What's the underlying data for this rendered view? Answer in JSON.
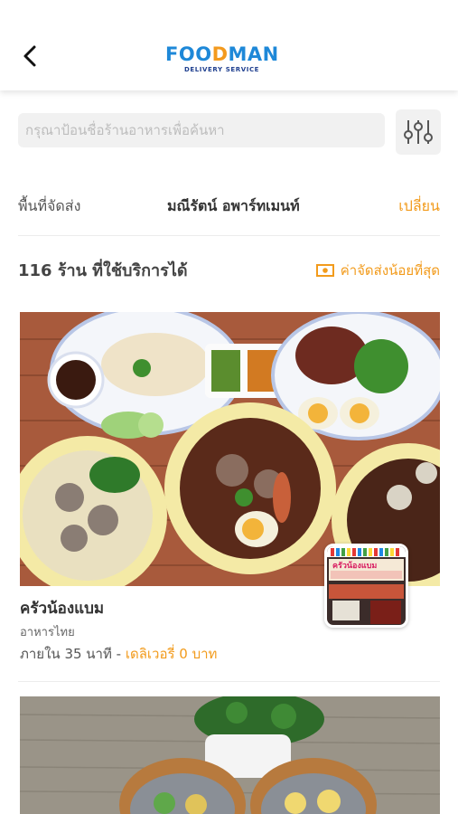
{
  "header": {
    "logo_part1": "FOO",
    "logo_part2": "D",
    "logo_part3": "MAN",
    "logo_subtitle": "DELIVERY SERVICE",
    "back_icon": "chevron-left-icon"
  },
  "search": {
    "placeholder": "กรุณาป้อนชื่อร้านอาหารเพื่อค้นหา",
    "filter_icon": "sliders-icon"
  },
  "delivery_area": {
    "label": "พื้นที่จัดส่ง",
    "value": "มณีรัตน์ อพาร์ทเมนท์",
    "change_label": "เปลี่ยน"
  },
  "results": {
    "count_text": "116 ร้าน ที่ใช้บริการได้",
    "sort_label": "ค่าจัดส่งน้อยที่สุด",
    "sort_icon": "money-icon"
  },
  "restaurants": [
    {
      "name": "ครัวน้องแบม",
      "category": "อาหารไทย",
      "time": "ภายใน 35 นาที - ",
      "delivery_fee": "เดลิเวอรี่ 0 บาท",
      "storefront_sign": "ครัวน้องแบม"
    }
  ],
  "colors": {
    "accent": "#f29b1c",
    "logo_blue": "#1e88d8",
    "logo_orange": "#f39a1e"
  }
}
